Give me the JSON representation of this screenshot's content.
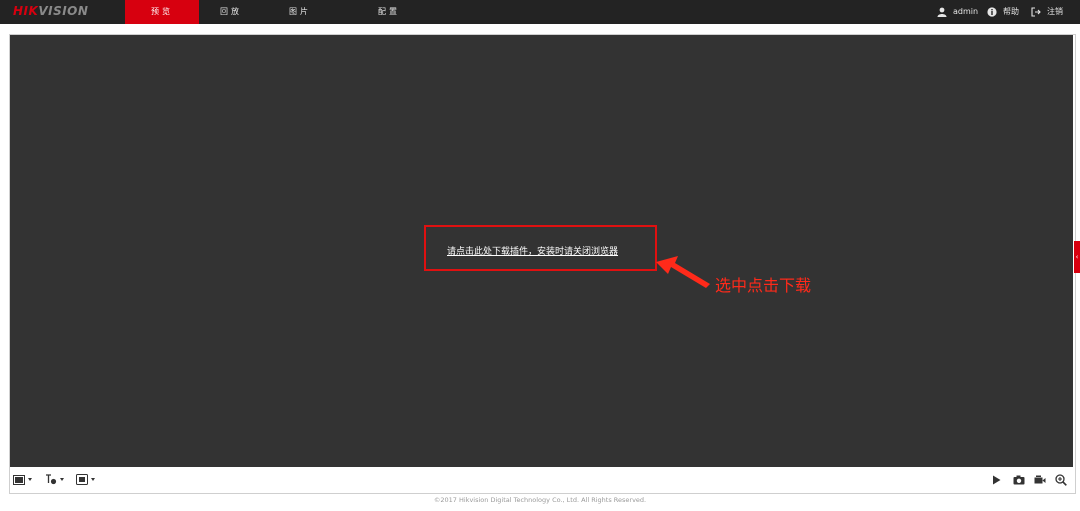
{
  "header": {
    "logo_red": "HIK",
    "logo_grey": "VISION",
    "tabs": [
      {
        "label": "预览",
        "active": true
      },
      {
        "label": "回放",
        "active": false
      },
      {
        "label": "图片",
        "active": false
      },
      {
        "label": "配置",
        "active": false
      }
    ],
    "user": "admin",
    "help": "帮助",
    "logout": "注销"
  },
  "video": {
    "plugin_link": "请点击此处下载插件，安装时请关闭浏览器",
    "annotation": "选中点击下载"
  },
  "toolbar": {
    "left_buttons": [
      "window-layout-icon",
      "stream-type-icon",
      "channel-icon"
    ],
    "right_buttons": [
      "play-icon",
      "capture-icon",
      "record-icon",
      "zoom-icon"
    ]
  },
  "footer": "©2017 Hikvision Digital Technology Co., Ltd. All Rights Reserved.",
  "colors": {
    "accent": "#d7000f",
    "topbar": "#232323",
    "video_bg": "#333333",
    "annotation": "#ff2a1a"
  }
}
